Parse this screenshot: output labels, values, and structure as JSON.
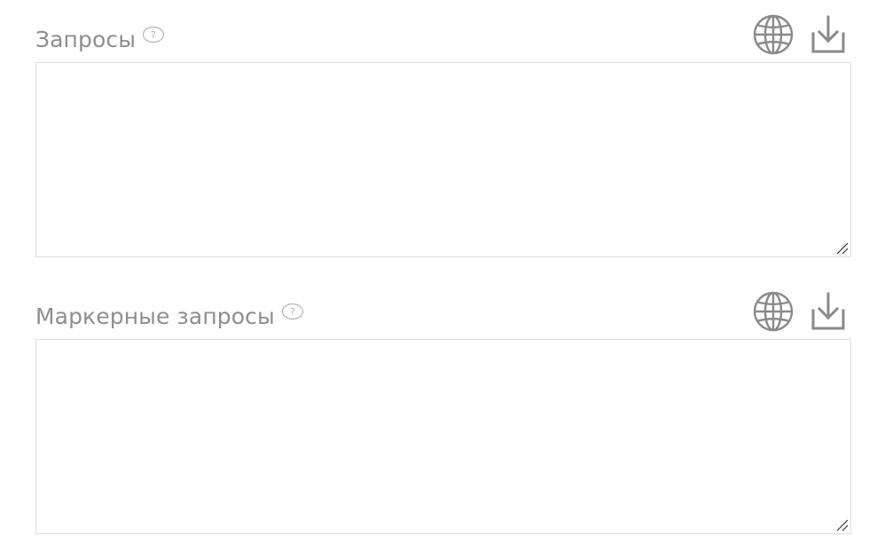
{
  "fields": [
    {
      "label": "Запросы",
      "value": "",
      "placeholder": "",
      "help_icon": "question-mark-icon",
      "actions": [
        {
          "icon": "globe-icon"
        },
        {
          "icon": "download-icon"
        }
      ]
    },
    {
      "label": "Маркерные запросы",
      "value": "",
      "placeholder": "",
      "help_icon": "question-mark-icon",
      "actions": [
        {
          "icon": "globe-icon"
        },
        {
          "icon": "download-icon"
        }
      ]
    }
  ],
  "colors": {
    "label": "#8e8e8e",
    "icon": "#8a8a8a",
    "help_icon": "#b5b5b5",
    "border": "#dedede",
    "background": "#ffffff"
  }
}
